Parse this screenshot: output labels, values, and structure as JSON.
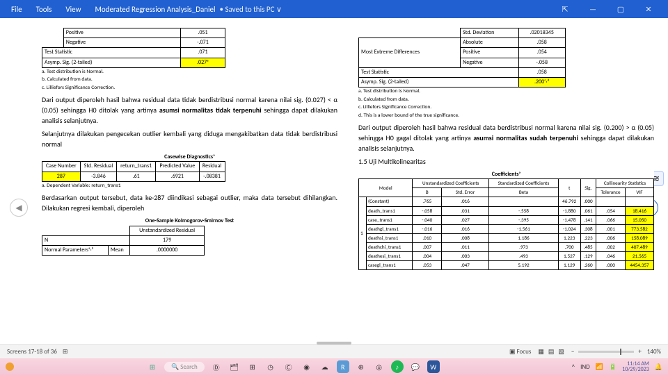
{
  "titlebar": {
    "file": "File",
    "tools": "Tools",
    "view": "View",
    "docname": "Moderated Regression Analysis_Daniel",
    "saved": "• Saved to this PC ∨"
  },
  "left": {
    "topTable": {
      "r1c1": "Positive",
      "r1c2": ".051",
      "r2c1": "Negative",
      "r2c2": "-.071",
      "r3c1": "Test Statistic",
      "r3c2": ".071",
      "r4c1": "Asymp. Sig. (2-tailed)",
      "r4c2": ".027ᵃ"
    },
    "notes": {
      "a": "a. Test distribution is Normal.",
      "b": "b. Calculated from data.",
      "c": "c. Lilliefors Significance Correction."
    },
    "p1": "Dari output diperoleh hasil bahwa residual data tidak berdistribusi normal karena nilai sig. (0.027) < α (0.05) sehingga H0 ditolak yang artinya ",
    "p1b": "asumsi normalitas tidak terpenuhi",
    "p1c": " sehingga dapat dilakukan analisis selanjutnya.",
    "p2": "Selanjutnya dilakukan pengecekan outlier kembali yang diduga mengakibatkan data tidak berdistribusi normal",
    "cdTitle": "Casewise Diagnosticsᵃ",
    "cd": {
      "h1": "Case Number",
      "h2": "Std. Residual",
      "h3": "return_trans1",
      "h4": "Predicted Value",
      "h5": "Residual",
      "c1": "287",
      "c2": "-3.846",
      "c3": ".61",
      "c4": ".6921",
      "c5": "-.08381"
    },
    "depnote": "a. Dependent Variable: return_trans1",
    "p3": "Berdasarkan output tersebut, data ke-287 diindikasi sebagai outlier, maka data tersebut dihilangkan. Dilakukan regresi kembali, diperoleh",
    "ksTitle": "One-Sample Kolmogorov-Smirnov Test",
    "ks": {
      "h": "Unstandardized Residual",
      "n": "N",
      "nval": "179",
      "npar": "Normal Parametersᵃ·ᵇ",
      "mean": "Mean",
      "meanval": ".0000000"
    }
  },
  "right": {
    "topTable": {
      "r0c1": "Std. Deviation",
      "r0c2": ".02018345",
      "g": "Most Extreme Differences",
      "r1c1": "Absolute",
      "r1c2": ".058",
      "r2c1": "Positive",
      "r2c2": ".054",
      "r3c1": "Negative",
      "r3c2": "-.058",
      "ts": "Test Statistic",
      "tsv": ".058",
      "as": "Asymp. Sig. (2-tailed)",
      "asv": ".200ᶜ·ᵈ"
    },
    "notes": {
      "a": "a. Test distribution is Normal.",
      "b": "b. Calculated from data.",
      "c": "c. Lilliefors Significance Correction.",
      "d": "d. This is a lower bound of the true significance."
    },
    "p1": "Dari output diperoleh hasil bahwa residual data berdistribusi normal karena nilai sig. (0.200) > α (0.05) sehingga H0 gagal ditolak yang artinya ",
    "p1b": "asumsi normalitas sudah terpenuhi",
    "p1c": " sehingga dapat dilakukan analisis selanjutnya.",
    "sec": "1.5 Uji Multikolinearitas",
    "coefTitle": "Coefficientsᵃ",
    "coef": {
      "uh": "Unstandardized Coefficients",
      "sh": "Standardized Coefficients",
      "cs": "Collinearity Statistics",
      "b": "B",
      "se": "Std. Error",
      "beta": "Beta",
      "t": "t",
      "sig": "Sig.",
      "tol": "Tolerance",
      "vif": "VIF",
      "model": "Model",
      "const": "(Constant)",
      "m1": "1",
      "rows": [
        {
          "n": "(Constant)",
          "b": ".765",
          "se": ".016",
          "beta": "",
          "t": "46.792",
          "sig": ".000",
          "tol": "",
          "vif": ""
        },
        {
          "n": "death_trans1",
          "b": "-.058",
          "se": ".031",
          "beta": "-.558",
          "t": "-1.880",
          "sig": ".061",
          "tol": ".054",
          "vif": "18.416"
        },
        {
          "n": "case_trans1",
          "b": "-.040",
          "se": ".027",
          "beta": "-.395",
          "t": "-1.478",
          "sig": ".141",
          "tol": ".066",
          "vif": "15.050"
        },
        {
          "n": "deathgl_trans1",
          "b": "-.016",
          "se": ".016",
          "beta": "-1.561",
          "t": "-1.024",
          "sig": ".308",
          "tol": ".001",
          "vif": "773.582"
        },
        {
          "n": "deathsi_trans1",
          "b": ".010",
          "se": ".008",
          "beta": "1.186",
          "t": "1.223",
          "sig": ".223",
          "tol": ".006",
          "vif": "158.089"
        },
        {
          "n": "deathchi_trans1",
          "b": ".007",
          "se": ".011",
          "beta": ".973",
          "t": ".700",
          "sig": ".485",
          "tol": ".002",
          "vif": "407.489"
        },
        {
          "n": "deathesi_trans1",
          "b": ".004",
          "se": ".003",
          "beta": ".493",
          "t": "1.527",
          "sig": ".129",
          "tol": ".046",
          "vif": "21.565"
        },
        {
          "n": "casegl_trans1",
          "b": ".053",
          "se": ".047",
          "beta": "5.192",
          "t": "1.129",
          "sig": ".260",
          "tol": ".000",
          "vif": "4454.357"
        }
      ]
    }
  },
  "status": {
    "screens": "Screens 17-18 of 36",
    "focus": "Focus",
    "zoom": "140%"
  },
  "taskbar": {
    "search": "Search",
    "time": "11:14 AM",
    "date": "10/29/2023",
    "lang": "IND"
  }
}
